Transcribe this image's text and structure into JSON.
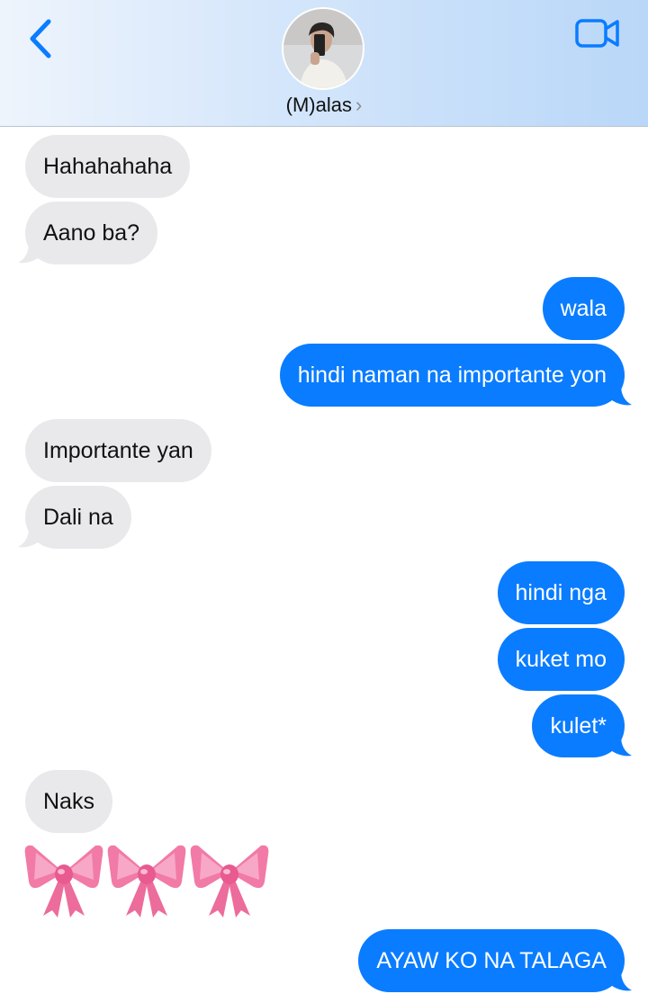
{
  "header": {
    "contact_name": "(M)alas",
    "chevron": "›",
    "back_icon": "chevron-left-icon",
    "video_icon": "video-camera-icon"
  },
  "colors": {
    "sent_bubble": "#0a7cff",
    "received_bubble": "#e9e9eb",
    "accent": "#0a7cff"
  },
  "messages": [
    {
      "from": "them",
      "text": "Hahahahaha"
    },
    {
      "from": "them",
      "text": "Aano ba?"
    },
    {
      "from": "me",
      "text": "wala"
    },
    {
      "from": "me",
      "text": "hindi naman na importante yon"
    },
    {
      "from": "them",
      "text": "Importante yan"
    },
    {
      "from": "them",
      "text": "Dali na"
    },
    {
      "from": "me",
      "text": "hindi nga"
    },
    {
      "from": "me",
      "text": "kuket mo"
    },
    {
      "from": "me",
      "text": "kulet*"
    },
    {
      "from": "them",
      "text": "Naks"
    },
    {
      "from": "them",
      "text": "🎀🎀🎀",
      "emoji": "pink-ribbon-bow x3"
    },
    {
      "from": "me",
      "text": "AYAW KO NA TALAGA"
    }
  ]
}
